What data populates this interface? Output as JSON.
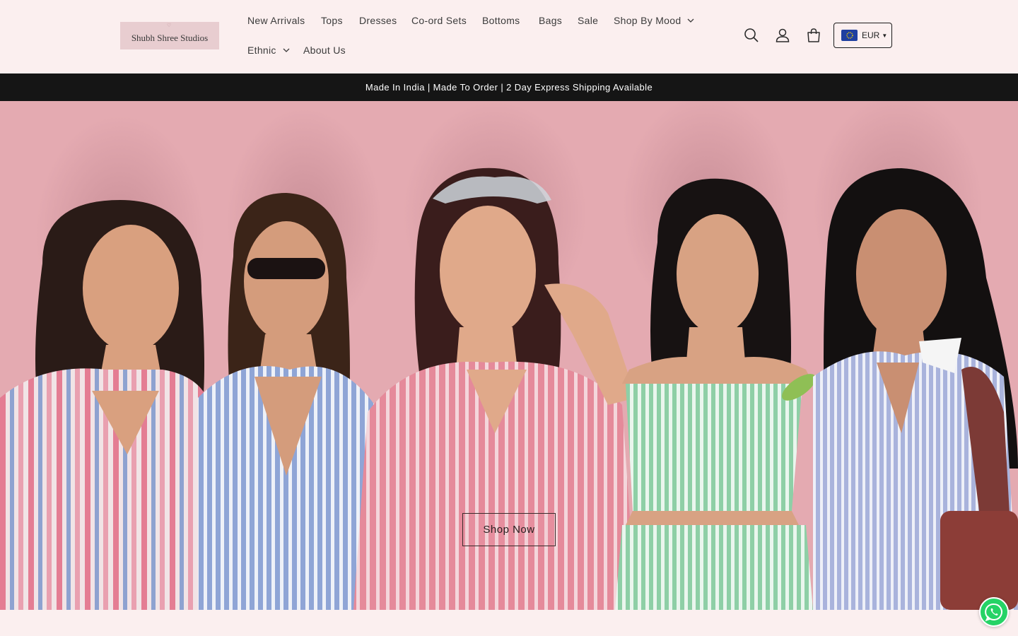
{
  "brand": {
    "name": "Shubh Shree Studios"
  },
  "nav": {
    "new_arrivals": "New Arrivals",
    "tops": "Tops",
    "dresses": "Dresses",
    "coord_sets": "Co-ord Sets",
    "bottoms": "Bottoms",
    "bags": "Bags",
    "sale": "Sale",
    "shop_by_mood": "Shop By Mood",
    "ethnic": "Ethnic",
    "about_us": "About Us"
  },
  "currency": {
    "code": "EUR"
  },
  "announcement": {
    "text": "Made In India | Made To Order | 2 Day Express Shipping Available"
  },
  "hero": {
    "cta_label": "Shop Now"
  },
  "colors": {
    "page_bg": "#fbefef",
    "announce_bg": "#151515",
    "hero_bg": "#e4aab1",
    "whatsapp": "#25d366"
  },
  "icons": [
    "search-icon",
    "account-icon",
    "cart-icon",
    "chevron-down-icon",
    "eu-flag-icon",
    "whatsapp-icon"
  ]
}
